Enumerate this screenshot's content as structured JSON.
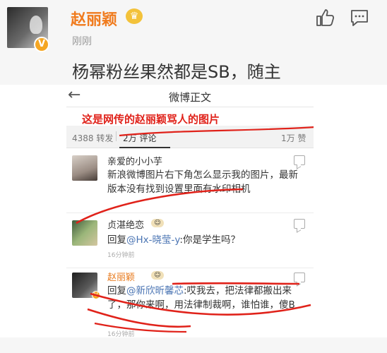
{
  "post": {
    "username": "赵丽颖",
    "verified_badge": "V",
    "crown_glyph": "♛",
    "time": "刚刚",
    "text": "杨幂粉丝果然都是SB，随主",
    "accent_color": "#f07b1e",
    "icons": [
      "like-icon",
      "comment-icon"
    ]
  },
  "screenshot": {
    "back_glyph": "←",
    "nav_title": "微博正文",
    "annotation_caption": "这是网传的赵丽颖骂人的图片",
    "annotation_color": "#e0221a",
    "stats": {
      "repost": "4388 转发",
      "comment": "2万 评论",
      "like": "1万 赞"
    },
    "comments": [
      {
        "name": "亲爱的小小芋",
        "text": "新浪微博图片右下角怎么显示我的图片，最新版本没有找到设置里面有水印相机",
        "time": ""
      },
      {
        "name": "贞湛绝恋",
        "icon_glyph": "☺",
        "reply_prefix": "回复",
        "mention": "@Hx-晓莹-y",
        "text": ":你是学生吗？",
        "time": "16分钟前"
      },
      {
        "name": "赵丽颖",
        "icon_glyph": "☺",
        "reply_prefix": "回复",
        "mention": "@新欣昕馨芯",
        "text": ":哎我去，把法律都搬出来了，那你来啊，用法律制裁啊，谁怕谁，傻B",
        "time": "16分钟前"
      }
    ]
  }
}
